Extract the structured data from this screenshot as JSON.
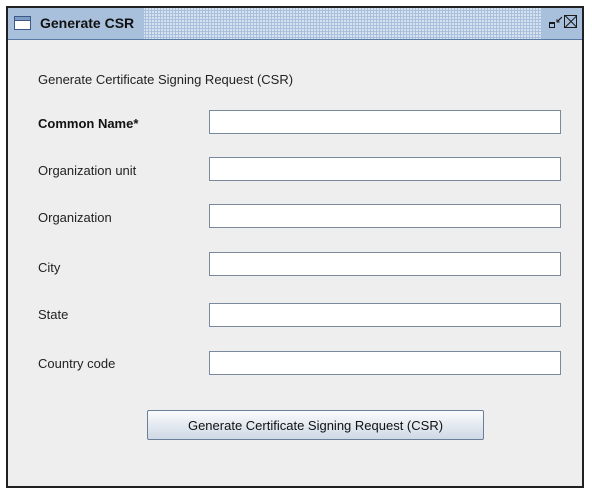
{
  "window": {
    "title": "Generate CSR",
    "icon": "window-icon",
    "controls": {
      "restore_icon": "restore-icon",
      "close_icon": "close-icon"
    }
  },
  "form": {
    "heading": "Generate Certificate Signing Request (CSR)",
    "fields": [
      {
        "label": "Common Name*",
        "value": ""
      },
      {
        "label": "Organization unit",
        "value": ""
      },
      {
        "label": "Organization",
        "value": ""
      },
      {
        "label": "City",
        "value": ""
      },
      {
        "label": "State",
        "value": ""
      },
      {
        "label": "Country code",
        "value": ""
      }
    ],
    "submit_label": "Generate Certificate Signing Request (CSR)"
  },
  "colors": {
    "titlebar": "#a9c0dc",
    "window_bg": "#eeeeee",
    "field_border": "#7a8a9c"
  }
}
